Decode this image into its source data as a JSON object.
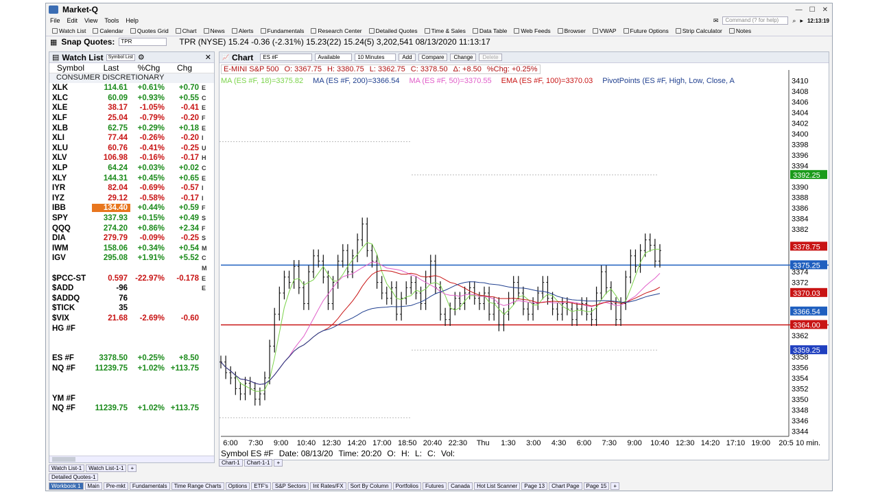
{
  "app": {
    "title": "Market-Q",
    "clock": "12:13:19",
    "command_placeholder": "Command (? for help)"
  },
  "menu": [
    "File",
    "Edit",
    "View",
    "Tools",
    "Help"
  ],
  "toolbar": [
    "Watch List",
    "Calendar",
    "Quotes Grid",
    "Chart",
    "News",
    "Alerts",
    "Fundamentals",
    "Research Center",
    "Detailed Quotes",
    "Time & Sales",
    "Data Table",
    "Web Feeds",
    "Browser",
    "VWAP",
    "Future Options",
    "Strip Calculator",
    "Notes"
  ],
  "snap": {
    "label": "Snap Quotes:",
    "input": "TPR",
    "quote": "TPR (NYSE) 15.24 -0.36 (-2.31%) 15.23(22) 15.24(5) 3,202,541 08/13/2020 11:13:17"
  },
  "watchlist": {
    "title": "Watch List",
    "symbol_list_btn": "Symbol List",
    "columns": [
      "Symbol",
      "Last",
      "%Chg",
      "Chg"
    ],
    "sector": "CONSUMER DISCRETIONARY",
    "rows": [
      {
        "sym": "XLK",
        "last": "114.61",
        "pct": "+0.61%",
        "chg": "+0.70",
        "dir": "pos",
        "flag": "E"
      },
      {
        "sym": "XLC",
        "last": "60.09",
        "pct": "+0.93%",
        "chg": "+0.55",
        "dir": "pos",
        "flag": "C"
      },
      {
        "sym": "XLE",
        "last": "38.17",
        "pct": "-1.05%",
        "chg": "-0.41",
        "dir": "neg",
        "flag": "E"
      },
      {
        "sym": "XLF",
        "last": "25.04",
        "pct": "-0.79%",
        "chg": "-0.20",
        "dir": "neg",
        "flag": "F"
      },
      {
        "sym": "XLB",
        "last": "62.75",
        "pct": "+0.29%",
        "chg": "+0.18",
        "dir": "pos",
        "flag": "E"
      },
      {
        "sym": "XLI",
        "last": "77.44",
        "pct": "-0.26%",
        "chg": "-0.20",
        "dir": "neg",
        "flag": "I"
      },
      {
        "sym": "XLU",
        "last": "60.76",
        "pct": "-0.41%",
        "chg": "-0.25",
        "dir": "neg",
        "flag": "U"
      },
      {
        "sym": "XLV",
        "last": "106.98",
        "pct": "-0.16%",
        "chg": "-0.17",
        "dir": "neg",
        "flag": "H"
      },
      {
        "sym": "XLP",
        "last": "64.24",
        "pct": "+0.03%",
        "chg": "+0.02",
        "dir": "pos",
        "flag": "C"
      },
      {
        "sym": "XLY",
        "last": "144.31",
        "pct": "+0.45%",
        "chg": "+0.65",
        "dir": "pos",
        "flag": "E"
      },
      {
        "sym": "IYR",
        "last": "82.04",
        "pct": "-0.69%",
        "chg": "-0.57",
        "dir": "neg",
        "flag": "I"
      },
      {
        "sym": "IYZ",
        "last": "29.12",
        "pct": "-0.58%",
        "chg": "-0.17",
        "dir": "neg",
        "flag": "I"
      },
      {
        "sym": "IBB",
        "last": "134.40",
        "pct": "+0.44%",
        "chg": "+0.59",
        "dir": "pos",
        "flag": "F",
        "highlight": true
      },
      {
        "sym": "SPY",
        "last": "337.93",
        "pct": "+0.15%",
        "chg": "+0.49",
        "dir": "pos",
        "flag": "S"
      },
      {
        "sym": "QQQ",
        "last": "274.20",
        "pct": "+0.86%",
        "chg": "+2.34",
        "dir": "pos",
        "flag": "F"
      },
      {
        "sym": "DIA",
        "last": "279.79",
        "pct": "-0.09%",
        "chg": "-0.25",
        "dir": "neg",
        "flag": "S"
      },
      {
        "sym": "IWM",
        "last": "158.06",
        "pct": "+0.34%",
        "chg": "+0.54",
        "dir": "pos",
        "flag": "M"
      },
      {
        "sym": "IGV",
        "last": "295.08",
        "pct": "+1.91%",
        "chg": "+5.52",
        "dir": "pos",
        "flag": "C"
      },
      {
        "sym": "",
        "last": "",
        "pct": "",
        "chg": "",
        "dir": "blk",
        "flag": "M"
      },
      {
        "sym": "$PCC-ST",
        "last": "0.597",
        "pct": "-22.97%",
        "chg": "-0.178",
        "dir": "neg",
        "flag": "E"
      },
      {
        "sym": "$ADD",
        "last": "-96",
        "pct": "",
        "chg": "",
        "dir": "blk",
        "flag": "E"
      },
      {
        "sym": "$ADDQ",
        "last": "76",
        "pct": "",
        "chg": "",
        "dir": "blk",
        "flag": ""
      },
      {
        "sym": "$TICK",
        "last": "35",
        "pct": "",
        "chg": "",
        "dir": "blk",
        "flag": ""
      },
      {
        "sym": "$VIX",
        "last": "21.68",
        "pct": "-2.69%",
        "chg": "-0.60",
        "dir": "neg",
        "flag": ""
      },
      {
        "sym": "HG #F",
        "last": "",
        "pct": "",
        "chg": "",
        "dir": "blk",
        "flag": ""
      },
      {
        "sym": "",
        "last": "",
        "pct": "",
        "chg": "",
        "dir": "blk",
        "flag": ""
      },
      {
        "sym": "",
        "last": "",
        "pct": "",
        "chg": "",
        "dir": "blk",
        "flag": ""
      },
      {
        "sym": "ES #F",
        "last": "3378.50",
        "pct": "+0.25%",
        "chg": "+8.50",
        "dir": "pos",
        "flag": ""
      },
      {
        "sym": "NQ #F",
        "last": "11239.75",
        "pct": "+1.02%",
        "chg": "+113.75",
        "dir": "pos",
        "flag": ""
      },
      {
        "sym": "",
        "last": "",
        "pct": "",
        "chg": "",
        "dir": "blk",
        "flag": ""
      },
      {
        "sym": "",
        "last": "",
        "pct": "",
        "chg": "",
        "dir": "blk",
        "flag": ""
      },
      {
        "sym": "YM #F",
        "last": "",
        "pct": "",
        "chg": "",
        "dir": "blk",
        "flag": ""
      },
      {
        "sym": "NQ #F",
        "last": "11239.75",
        "pct": "+1.02%",
        "chg": "+113.75",
        "dir": "pos",
        "flag": ""
      }
    ]
  },
  "chart": {
    "title": "Chart",
    "symbol_input": "ES #F",
    "available": "Available",
    "interval": "10 Minutes",
    "buttons": [
      "Add",
      "Compare",
      "Change",
      "Delete"
    ],
    "quote": {
      "name": "E-MINI S&P 500",
      "o": "O: 3367.75",
      "h": "H: 3380.75",
      "l": "L: 3362.75",
      "c": "C: 3378.50",
      "delta": "Δ: +8.50",
      "pct": "%Chg: +0.25%"
    },
    "indicators": [
      {
        "label": "MA (ES #F, 18)=3375.82",
        "color": "#7bd34a"
      },
      {
        "label": "MA (ES #F, 200)=3366.54",
        "color": "#1f3f8f"
      },
      {
        "label": "MA (ES #F, 50)=3370.55",
        "color": "#e05cc8"
      },
      {
        "label": "EMA (ES #F, 100)=3370.03",
        "color": "#c81414"
      },
      {
        "label": "PivotPoints (ES #F, High, Low, Close, A",
        "color": "#1f3f8f"
      }
    ],
    "status": {
      "symbol": "Symbol ES #F",
      "date": "Date: 08/13/20",
      "time": "Time: 20:20",
      "o": "O:",
      "h": "H:",
      "l": "L:",
      "c": "C:",
      "vol": "Vol:"
    },
    "tabs": [
      "Chart-1",
      "Chart-1-1"
    ]
  },
  "chart_data": {
    "type": "line",
    "title": "E-MINI S&P 500",
    "xlabel": "",
    "ylabel": "",
    "interval_label": "10 min.",
    "ylim": [
      3343,
      3412
    ],
    "y_ticks": [
      3410,
      3408,
      3406,
      3404,
      3402,
      3400,
      3398,
      3396,
      3394,
      3390,
      3388,
      3386,
      3384,
      3382,
      3374,
      3372,
      3362,
      3358,
      3356,
      3354,
      3352,
      3350,
      3348,
      3346,
      3344
    ],
    "x_ticks": [
      "6:00",
      "7:30",
      "9:00",
      "10:40",
      "12:30",
      "14:20",
      "17:00",
      "18:50",
      "20:40",
      "22:30",
      "Thu",
      "1:30",
      "3:00",
      "4:30",
      "6:00",
      "7:30",
      "9:00",
      "10:40",
      "12:30",
      "14:20",
      "17:10",
      "19:00",
      "20:5"
    ],
    "price_labels": [
      {
        "value": 3392.25,
        "text": "3392.25",
        "color": "#1b9b1b"
      },
      {
        "value": 3378.75,
        "text": "3378.75",
        "color": "#c81414"
      },
      {
        "value": 3375.25,
        "text": "3375.25",
        "color": "#1f5fbf"
      },
      {
        "value": 3370.03,
        "text": "3370.03",
        "color": "#c81414"
      },
      {
        "value": 3366.54,
        "text": "3366.54",
        "color": "#1f5fbf"
      },
      {
        "value": 3364.0,
        "text": "3364.00",
        "color": "#c81414"
      },
      {
        "value": 3359.25,
        "text": "3359.25",
        "color": "#1f3fbf"
      }
    ],
    "hlines": [
      {
        "value": 3375.25,
        "color": "#1f5fbf"
      },
      {
        "value": 3364.0,
        "color": "#c81414"
      }
    ],
    "close_series": [
      3357,
      3355,
      3354,
      3352,
      3351,
      3353,
      3352,
      3350,
      3351,
      3354,
      3360,
      3366,
      3370,
      3373,
      3372,
      3375,
      3371,
      3368,
      3374,
      3377,
      3376,
      3373,
      3368,
      3372,
      3376,
      3378,
      3374,
      3377,
      3380,
      3383,
      3378,
      3376,
      3372,
      3370,
      3369,
      3371,
      3366,
      3369,
      3371,
      3372,
      3370,
      3368,
      3373,
      3376,
      3371,
      3366,
      3365,
      3367,
      3369,
      3368,
      3370,
      3371,
      3369,
      3368,
      3370,
      3366,
      3368,
      3364,
      3366,
      3369,
      3372,
      3370,
      3367,
      3366,
      3368,
      3370,
      3372,
      3369,
      3367,
      3366,
      3368,
      3367,
      3365,
      3367,
      3368,
      3366,
      3365,
      3370,
      3374,
      3371,
      3368,
      3365,
      3368,
      3373,
      3377,
      3375,
      3378,
      3380,
      3379,
      3376,
      3378
    ]
  },
  "bottom": {
    "wl_tabs": [
      "Watch List-1",
      "Watch List-1-1"
    ],
    "detailed_quotes_tab": "Detailed Quotes-1",
    "workbook": "Workbook 1",
    "pages": [
      "Main",
      "Pre-mkt",
      "Fundamentals",
      "Time Range Charts",
      "Options",
      "ETF's",
      "S&P Sectors",
      "Int Rates/FX",
      "Sort By Column",
      "Portfolios",
      "Futures",
      "Canada",
      "Hot List Scanner",
      "Page 13",
      "Chart Page",
      "Page 15"
    ]
  }
}
